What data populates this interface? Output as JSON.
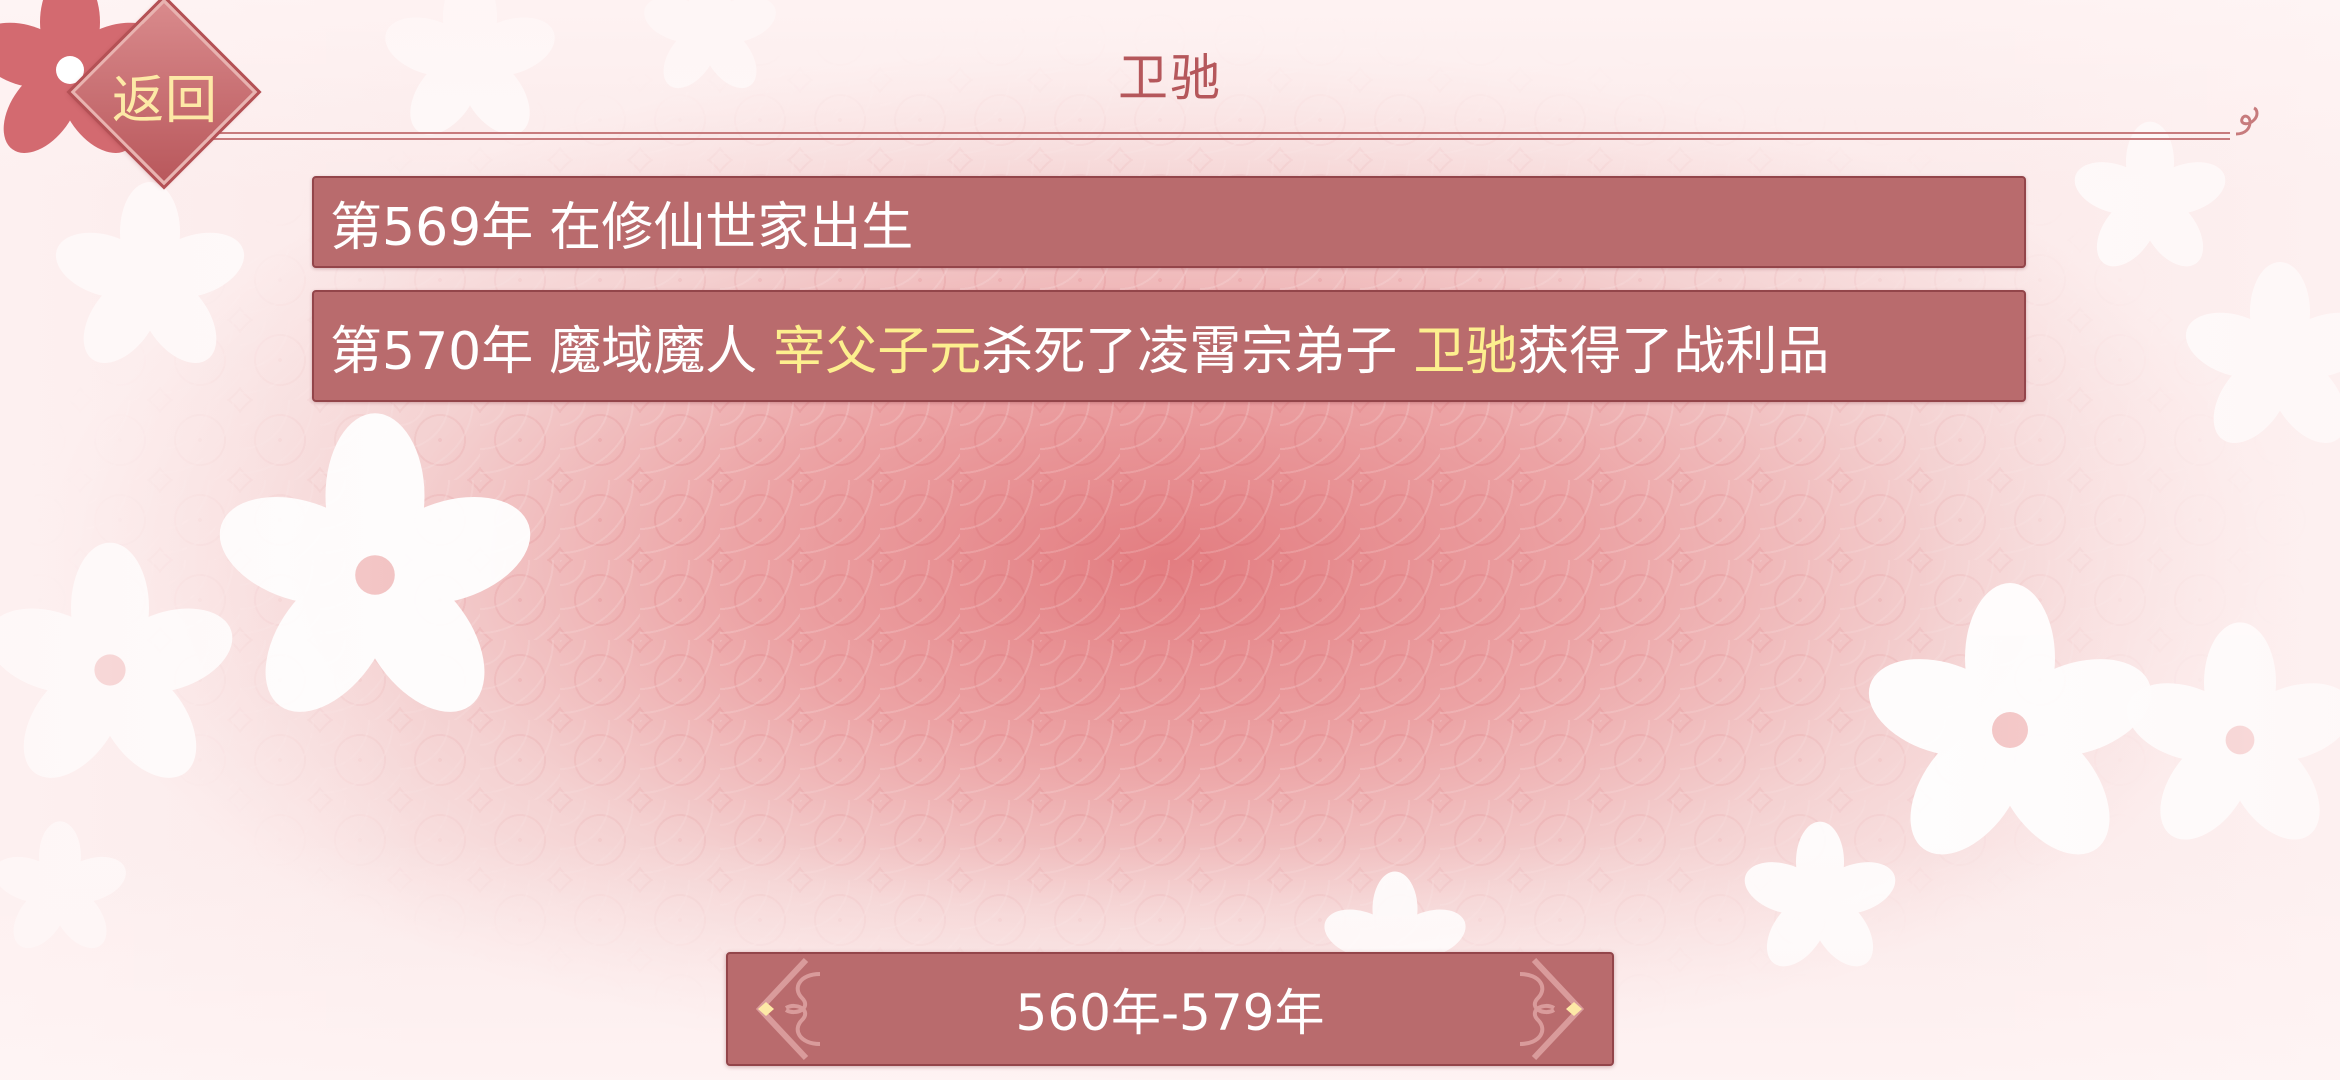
{
  "header": {
    "title": "卫驰",
    "back_label": "返回"
  },
  "events": [
    {
      "year": "第569年",
      "parts": [
        {
          "text": "在修仙世家出生",
          "highlight": false
        }
      ]
    },
    {
      "year": "第570年",
      "parts": [
        {
          "text": "魔域魔人",
          "highlight": false
        },
        {
          "text": "宰父子元",
          "highlight": true
        },
        {
          "text": "杀死了凌霄宗弟子",
          "highlight": false
        },
        {
          "text": "卫驰",
          "highlight": true
        },
        {
          "text": "获得了战利品",
          "highlight": false
        }
      ]
    }
  ],
  "period": {
    "label": "560年-579年"
  },
  "colors": {
    "row_bg": "#b96b6d",
    "highlight_text": "#fdef8e",
    "title_text": "#b5575b"
  },
  "icons": {
    "back": "diamond-back-icon",
    "prev": "chevron-left-icon",
    "next": "chevron-right-icon"
  }
}
